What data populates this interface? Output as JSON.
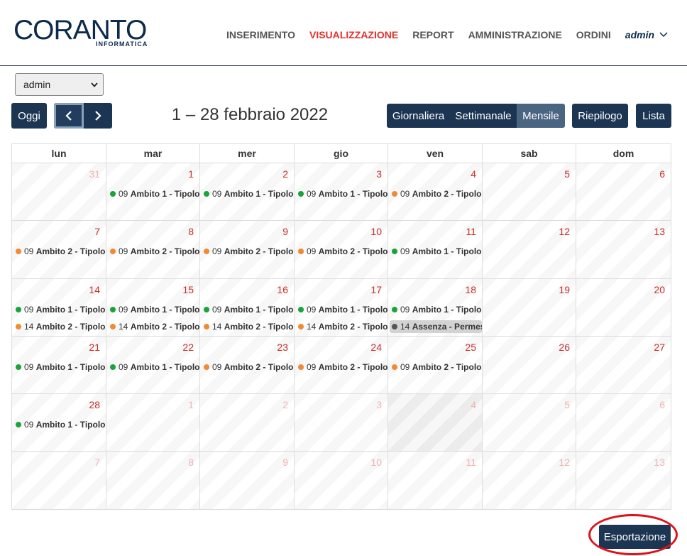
{
  "brand": {
    "name": "CORANTO",
    "subtitle": "INFORMATICA",
    "accent": "#e0312d",
    "navy": "#0d2a4a"
  },
  "nav": {
    "items": [
      {
        "label": "INSERIMENTO",
        "active": false
      },
      {
        "label": "VISUALIZZAZIONE",
        "active": true
      },
      {
        "label": "REPORT",
        "active": false
      },
      {
        "label": "AMMINISTRAZIONE",
        "active": false
      },
      {
        "label": "ORDINI",
        "active": false
      }
    ],
    "user": "admin"
  },
  "user_select": {
    "value": "admin"
  },
  "toolbar": {
    "today_label": "Oggi",
    "period_title": "1 – 28 febbraio 2022",
    "views": [
      {
        "label": "Giornaliera",
        "active": false
      },
      {
        "label": "Settimanale",
        "active": false
      },
      {
        "label": "Mensile",
        "active": true
      }
    ],
    "riepilogo_label": "Riepilogo",
    "lista_label": "Lista"
  },
  "calendar": {
    "weekdays": [
      "lun",
      "mar",
      "mer",
      "gio",
      "ven",
      "sab",
      "dom"
    ],
    "event_colors": {
      "green": "#1aa33a",
      "orange": "#f08a34",
      "gray": "#555555"
    },
    "weeks": [
      [
        {
          "day": "31",
          "other": true,
          "events": []
        },
        {
          "day": "1",
          "events": [
            {
              "prefix": "09",
              "bold": "Ambito 1",
              "rest": " - Tipologia",
              "color": "green"
            }
          ]
        },
        {
          "day": "2",
          "events": [
            {
              "prefix": "09",
              "bold": "Ambito 1",
              "rest": " - Tipologia",
              "color": "green"
            }
          ]
        },
        {
          "day": "3",
          "events": [
            {
              "prefix": "09",
              "bold": "Ambito 1",
              "rest": " - Tipologia",
              "color": "green"
            }
          ]
        },
        {
          "day": "4",
          "events": [
            {
              "prefix": "09",
              "bold": "Ambito 2",
              "rest": " - Tipologia",
              "color": "orange"
            }
          ]
        },
        {
          "day": "5",
          "events": []
        },
        {
          "day": "6",
          "events": []
        }
      ],
      [
        {
          "day": "7",
          "events": [
            {
              "prefix": "09",
              "bold": "Ambito 2",
              "rest": " - Tipologia",
              "color": "orange"
            }
          ]
        },
        {
          "day": "8",
          "events": [
            {
              "prefix": "09",
              "bold": "Ambito 2",
              "rest": " - Tipologia",
              "color": "orange"
            }
          ]
        },
        {
          "day": "9",
          "events": [
            {
              "prefix": "09",
              "bold": "Ambito 2",
              "rest": " - Tipologia",
              "color": "orange"
            }
          ]
        },
        {
          "day": "10",
          "events": [
            {
              "prefix": "09",
              "bold": "Ambito 2",
              "rest": " - Tipologia",
              "color": "orange"
            }
          ]
        },
        {
          "day": "11",
          "events": [
            {
              "prefix": "09",
              "bold": "Ambito 1",
              "rest": " - Tipologia",
              "color": "green"
            }
          ]
        },
        {
          "day": "12",
          "events": []
        },
        {
          "day": "13",
          "events": []
        }
      ],
      [
        {
          "day": "14",
          "events": [
            {
              "prefix": "09",
              "bold": "Ambito 1",
              "rest": " - Tipologia",
              "color": "green"
            },
            {
              "prefix": "14",
              "bold": "Ambito 2",
              "rest": " - Tipologia",
              "color": "orange"
            }
          ]
        },
        {
          "day": "15",
          "events": [
            {
              "prefix": "09",
              "bold": "Ambito 1",
              "rest": " - Tipologia",
              "color": "green"
            },
            {
              "prefix": "14",
              "bold": "Ambito 2",
              "rest": " - Tipologia",
              "color": "orange"
            }
          ]
        },
        {
          "day": "16",
          "events": [
            {
              "prefix": "09",
              "bold": "Ambito 1",
              "rest": " - Tipologia",
              "color": "green"
            },
            {
              "prefix": "14",
              "bold": "Ambito 2",
              "rest": " - Tipologia",
              "color": "orange"
            }
          ]
        },
        {
          "day": "17",
          "events": [
            {
              "prefix": "09",
              "bold": "Ambito 1",
              "rest": " - Tipologia",
              "color": "green"
            },
            {
              "prefix": "14",
              "bold": "Ambito 2",
              "rest": " - Tipologia",
              "color": "orange"
            }
          ]
        },
        {
          "day": "18",
          "events": [
            {
              "prefix": "09",
              "bold": "Ambito 1",
              "rest": " - Tipologia",
              "color": "green"
            },
            {
              "prefix": "14",
              "bold": "Assenza - Permesso",
              "rest": "",
              "color": "gray",
              "absence": true
            }
          ]
        },
        {
          "day": "19",
          "events": []
        },
        {
          "day": "20",
          "events": []
        }
      ],
      [
        {
          "day": "21",
          "events": [
            {
              "prefix": "09",
              "bold": "Ambito 1",
              "rest": " - Tipologia",
              "color": "green"
            }
          ]
        },
        {
          "day": "22",
          "events": [
            {
              "prefix": "09",
              "bold": "Ambito 1",
              "rest": " - Tipologia",
              "color": "green"
            }
          ]
        },
        {
          "day": "23",
          "events": [
            {
              "prefix": "09",
              "bold": "Ambito 2",
              "rest": " - Tipologia",
              "color": "orange"
            }
          ]
        },
        {
          "day": "24",
          "events": [
            {
              "prefix": "09",
              "bold": "Ambito 2",
              "rest": " - Tipologia",
              "color": "orange"
            }
          ]
        },
        {
          "day": "25",
          "events": [
            {
              "prefix": "09",
              "bold": "Ambito 2",
              "rest": " - Tipologia",
              "color": "orange"
            }
          ]
        },
        {
          "day": "26",
          "events": []
        },
        {
          "day": "27",
          "events": []
        }
      ],
      [
        {
          "day": "28",
          "events": [
            {
              "prefix": "09",
              "bold": "Ambito 1",
              "rest": " - Tipologia",
              "color": "green"
            }
          ]
        },
        {
          "day": "1",
          "other": true,
          "events": []
        },
        {
          "day": "2",
          "other": true,
          "events": []
        },
        {
          "day": "3",
          "other": true,
          "events": []
        },
        {
          "day": "4",
          "other": true,
          "dark": true,
          "events": []
        },
        {
          "day": "5",
          "other": true,
          "events": []
        },
        {
          "day": "6",
          "other": true,
          "events": []
        }
      ],
      [
        {
          "day": "7",
          "other": true,
          "events": []
        },
        {
          "day": "8",
          "other": true,
          "events": []
        },
        {
          "day": "9",
          "other": true,
          "events": []
        },
        {
          "day": "10",
          "other": true,
          "events": []
        },
        {
          "day": "11",
          "other": true,
          "events": []
        },
        {
          "day": "12",
          "other": true,
          "events": []
        },
        {
          "day": "13",
          "other": true,
          "events": []
        }
      ]
    ]
  },
  "export_label": "Esportazione"
}
